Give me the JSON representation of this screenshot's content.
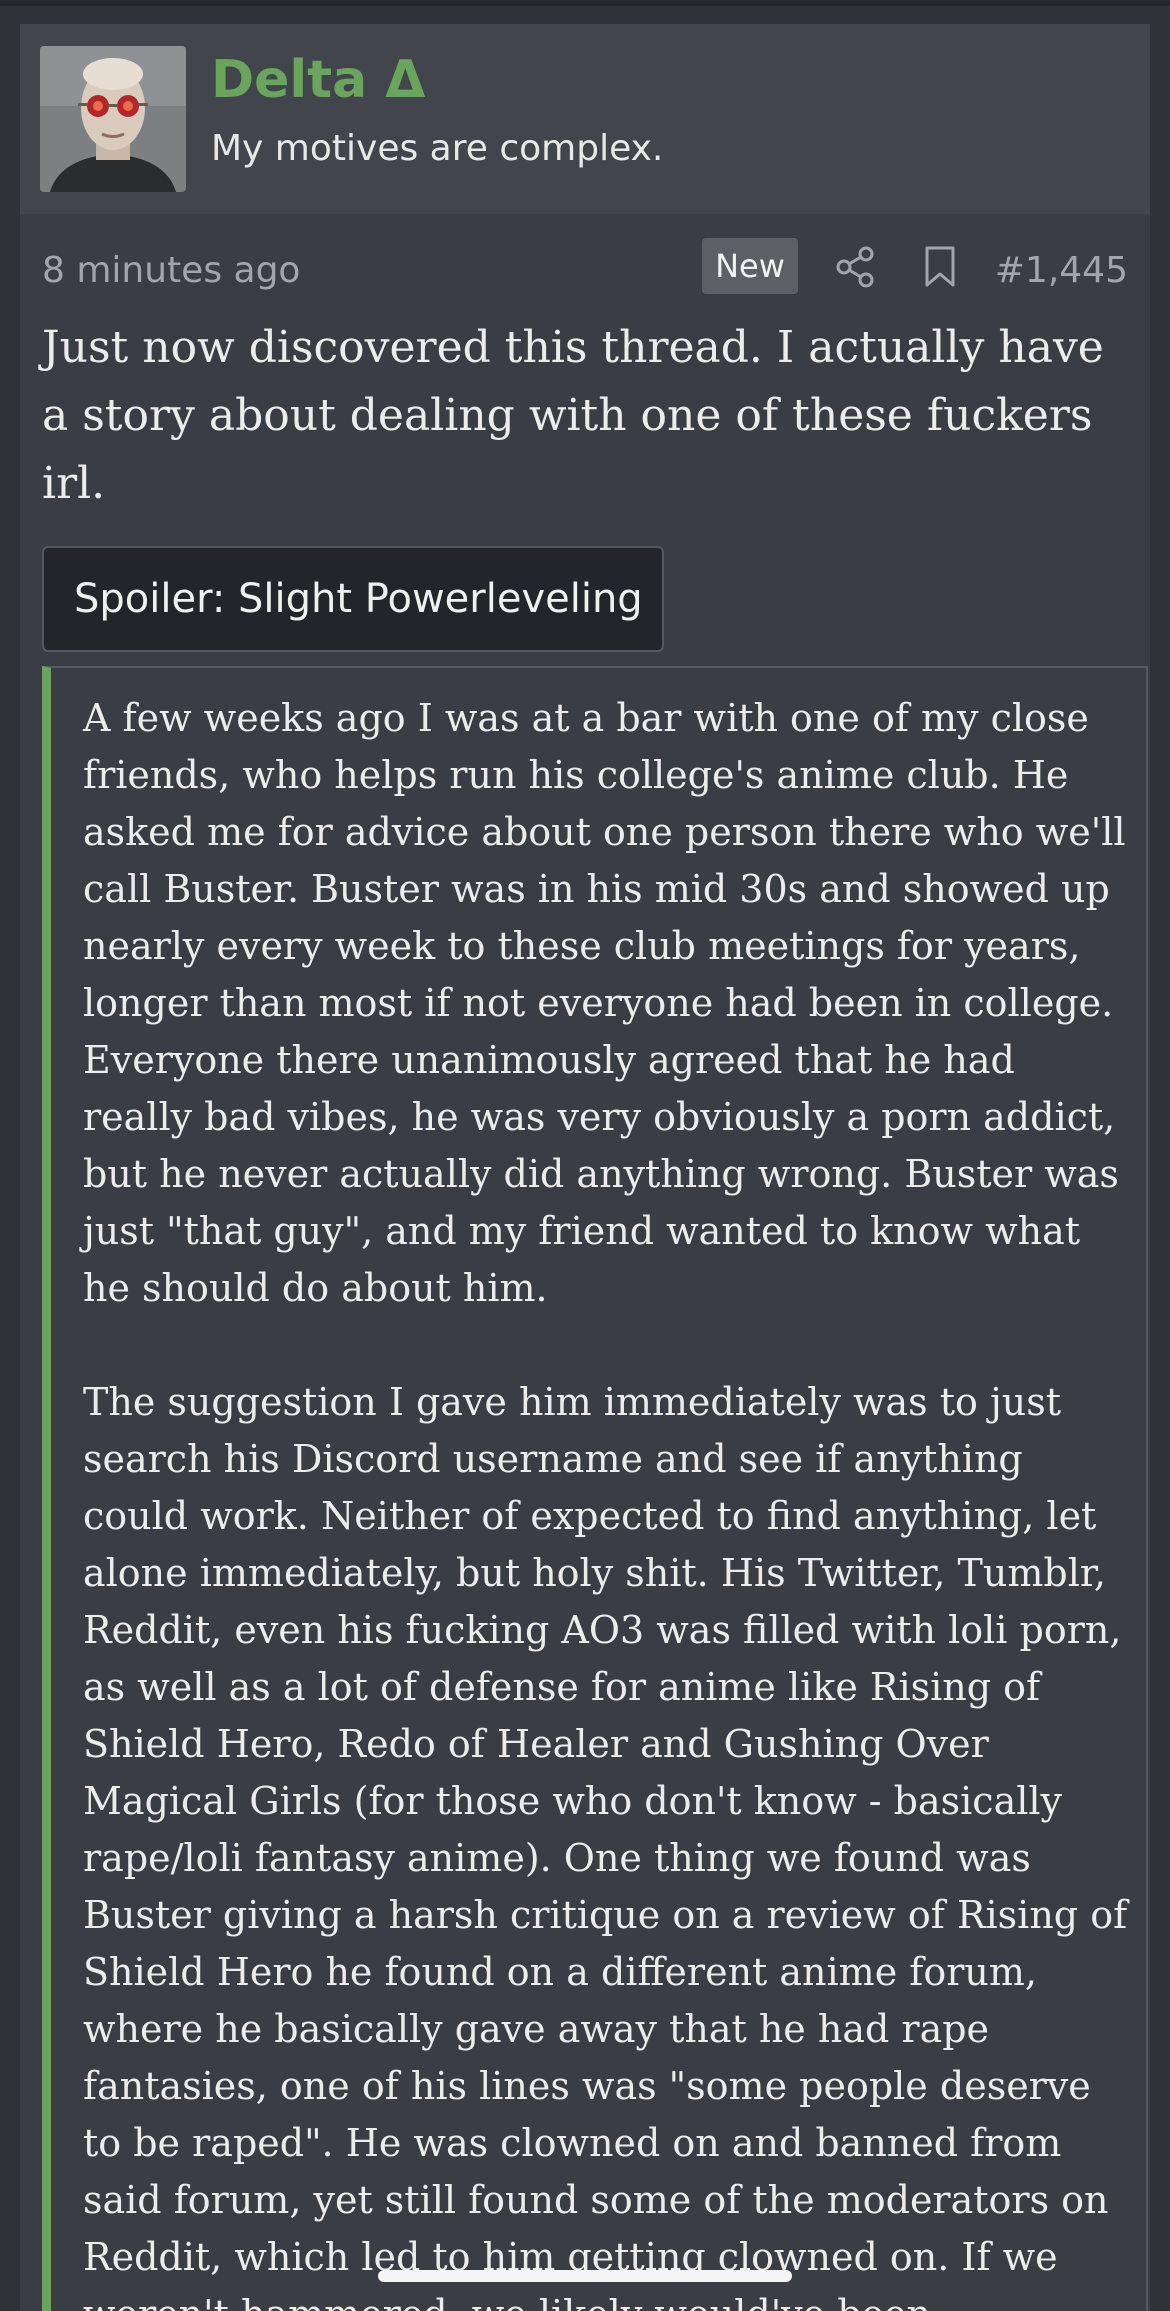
{
  "post": {
    "username": "Delta Δ",
    "user_title": "My motives are complex.",
    "timestamp": "8 minutes ago",
    "badge": "New",
    "post_number": "#1,445",
    "body": "Just now discovered this thread. I actually have a story about dealing with one of these fuckers irl.",
    "spoiler_label": "Spoiler: Slight Powerleveling",
    "spoiler_paragraphs": [
      "A few weeks ago I was at a bar with one of my close friends, who helps run his college's anime club. He asked me for advice about one person there who we'll call Buster. Buster was in his mid 30s and showed up nearly every week to these club meetings for years, longer than most if not everyone had been in college. Everyone there unanimously agreed that he had really bad vibes, he was very obviously a porn addict, but he never actually did anything wrong. Buster was just \"that guy\", and my friend wanted to know what he should do about him.",
      "The suggestion I gave him immediately was to just search his Discord username and see if anything could work. Neither of expected to find anything, let alone immediately, but holy shit. His Twitter, Tumblr, Reddit, even his fucking AO3 was filled with loli porn, as well as a lot of defense for anime like Rising of Shield Hero, Redo of Healer and Gushing Over Magical Girls (for those who don't know - basically rape/loli fantasy anime). One thing we found was Buster giving a harsh critique on a review of Rising of Shield Hero he found on a different anime forum, where he basically gave away that he had rape fantasies, one of his lines was \"some people deserve to be raped\". He was clowned on and banned from said forum, yet still found some of the moderators on Reddit, which led to him getting clowned on. If we weren't hammered, we likely would've been"
    ]
  },
  "icons": {
    "share": "share-icon",
    "bookmark": "bookmark-icon"
  },
  "colors": {
    "accent": "#6aa55d",
    "background": "#2f3237",
    "post_background": "#3a3e44",
    "header_background": "#42464c"
  }
}
